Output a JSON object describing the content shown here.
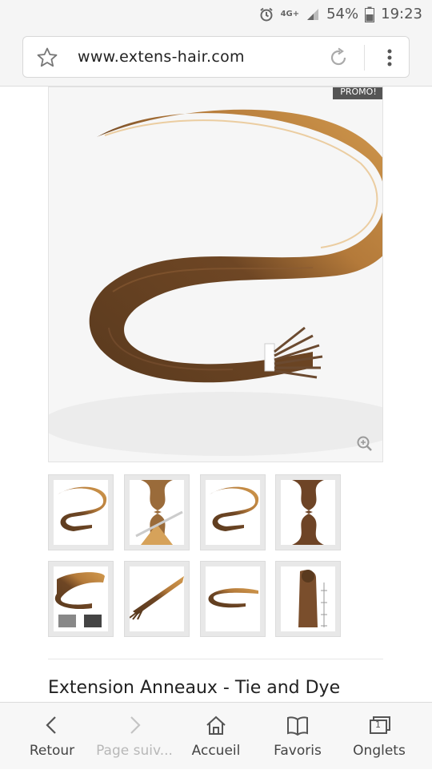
{
  "status_bar": {
    "network": "4G+",
    "battery": "54%",
    "time": "19:23"
  },
  "browser": {
    "url": "www.extens-hair.com"
  },
  "product": {
    "promo_badge": "PROMO!",
    "title": "Extension Anneaux - Tie and Dye"
  },
  "bottom_nav": {
    "back": "Retour",
    "forward": "Page suiv...",
    "home": "Accueil",
    "bookmarks": "Favoris",
    "tabs": "Onglets",
    "tabs_count": "1"
  },
  "colors": {
    "hair_dark": "#5a3a1e",
    "hair_light": "#c9924a"
  }
}
